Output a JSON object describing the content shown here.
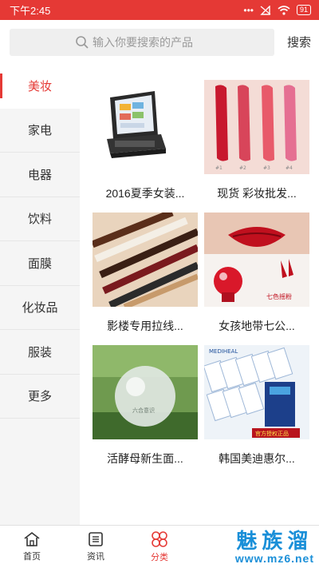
{
  "status_bar": {
    "time": "下午2:45",
    "signal_dots": "•••",
    "battery": "91"
  },
  "search": {
    "placeholder": "输入你要搜索的产品",
    "button_label": "搜索"
  },
  "sidebar": {
    "items": [
      {
        "label": "美妆",
        "active": true
      },
      {
        "label": "家电"
      },
      {
        "label": "电器"
      },
      {
        "label": "饮料"
      },
      {
        "label": "面膜"
      },
      {
        "label": "化妆品"
      },
      {
        "label": "服装"
      },
      {
        "label": "更多"
      }
    ]
  },
  "products": [
    {
      "title": "2016夏季女装...",
      "image": "pos-terminal"
    },
    {
      "title": "现货 彩妆批发...",
      "image": "lipstick-swatches"
    },
    {
      "title": "影楼专用拉线...",
      "image": "eyebrow-pencils"
    },
    {
      "title": "女孩地带七公...",
      "image": "red-lips-cherry"
    },
    {
      "title": "活酵母新生面...",
      "image": "crystal-sphere"
    },
    {
      "title": "韩国美迪惠尔...",
      "image": "mask-packs"
    }
  ],
  "image_text": {
    "swatch_labels": [
      "#1",
      "#2",
      "#3",
      "#4"
    ],
    "sphere_caption": "六合意识",
    "cherry_caption": "七色摇粉",
    "mask_brand": "MEDIHEAL",
    "mask_banner": "官方授权正品"
  },
  "tabbar": {
    "items": [
      {
        "label": "首页",
        "icon": "home-icon"
      },
      {
        "label": "资讯",
        "icon": "news-icon"
      },
      {
        "label": "分类",
        "icon": "category-icon",
        "active": true
      },
      {
        "label": "",
        "icon": ""
      },
      {
        "label": "",
        "icon": ""
      }
    ]
  },
  "watermark": {
    "name": "魅族溜",
    "url": "www.mz6.net"
  },
  "colors": {
    "accent": "#e53935",
    "watermark": "#1a8fd8"
  }
}
